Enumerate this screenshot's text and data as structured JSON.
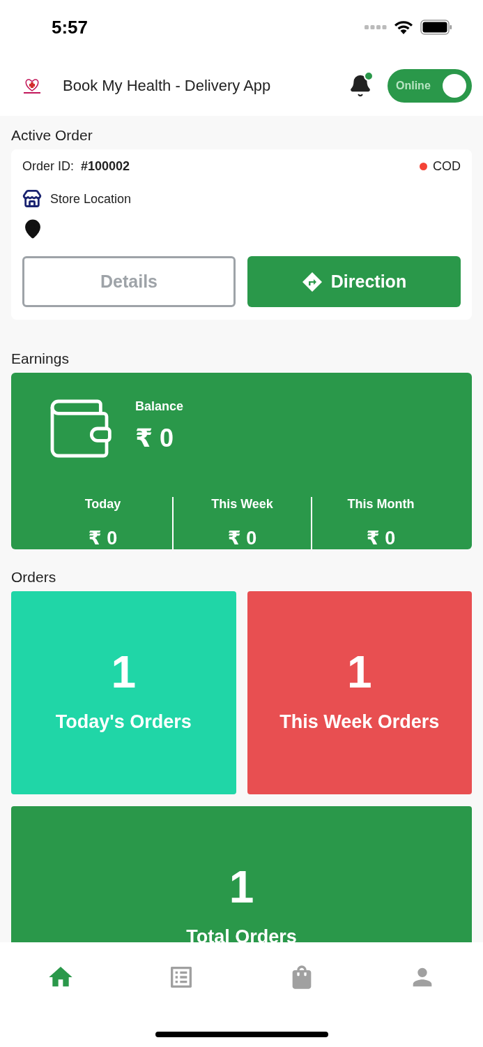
{
  "status_bar": {
    "time": "5:57"
  },
  "header": {
    "app_title": "Book My Health - Delivery App",
    "notification": {
      "unread": true
    },
    "status_toggle": {
      "label": "Online",
      "on": true
    }
  },
  "active_order": {
    "title": "Active Order",
    "order_id_label": "Order ID:",
    "order_id": "#100002",
    "payment": {
      "label": "COD",
      "color": "#f44336"
    },
    "store_label": "Store Location",
    "buttons": [
      {
        "label": "Details",
        "kind": "outline"
      },
      {
        "label": "Direction",
        "kind": "primary"
      }
    ]
  },
  "earnings": {
    "title": "Earnings",
    "balance_label": "Balance",
    "balance": "₹ 0",
    "periods": [
      {
        "label": "Today",
        "amount": "₹ 0"
      },
      {
        "label": "This Week",
        "amount": "₹ 0"
      },
      {
        "label": "This Month",
        "amount": "₹ 0"
      }
    ]
  },
  "orders": {
    "title": "Orders",
    "tiles": [
      {
        "count": "1",
        "label": "Today's Orders",
        "color": "#20d6a7"
      },
      {
        "count": "1",
        "label": "This Week Orders",
        "color": "#e84f51"
      },
      {
        "count": "1",
        "label": "Total Orders",
        "color": "#2a984a"
      }
    ]
  },
  "tab_bar": [
    {
      "kind": "home",
      "selected": true
    },
    {
      "kind": "list",
      "selected": false
    },
    {
      "kind": "bag",
      "selected": false
    },
    {
      "kind": "profile",
      "selected": false
    }
  ]
}
